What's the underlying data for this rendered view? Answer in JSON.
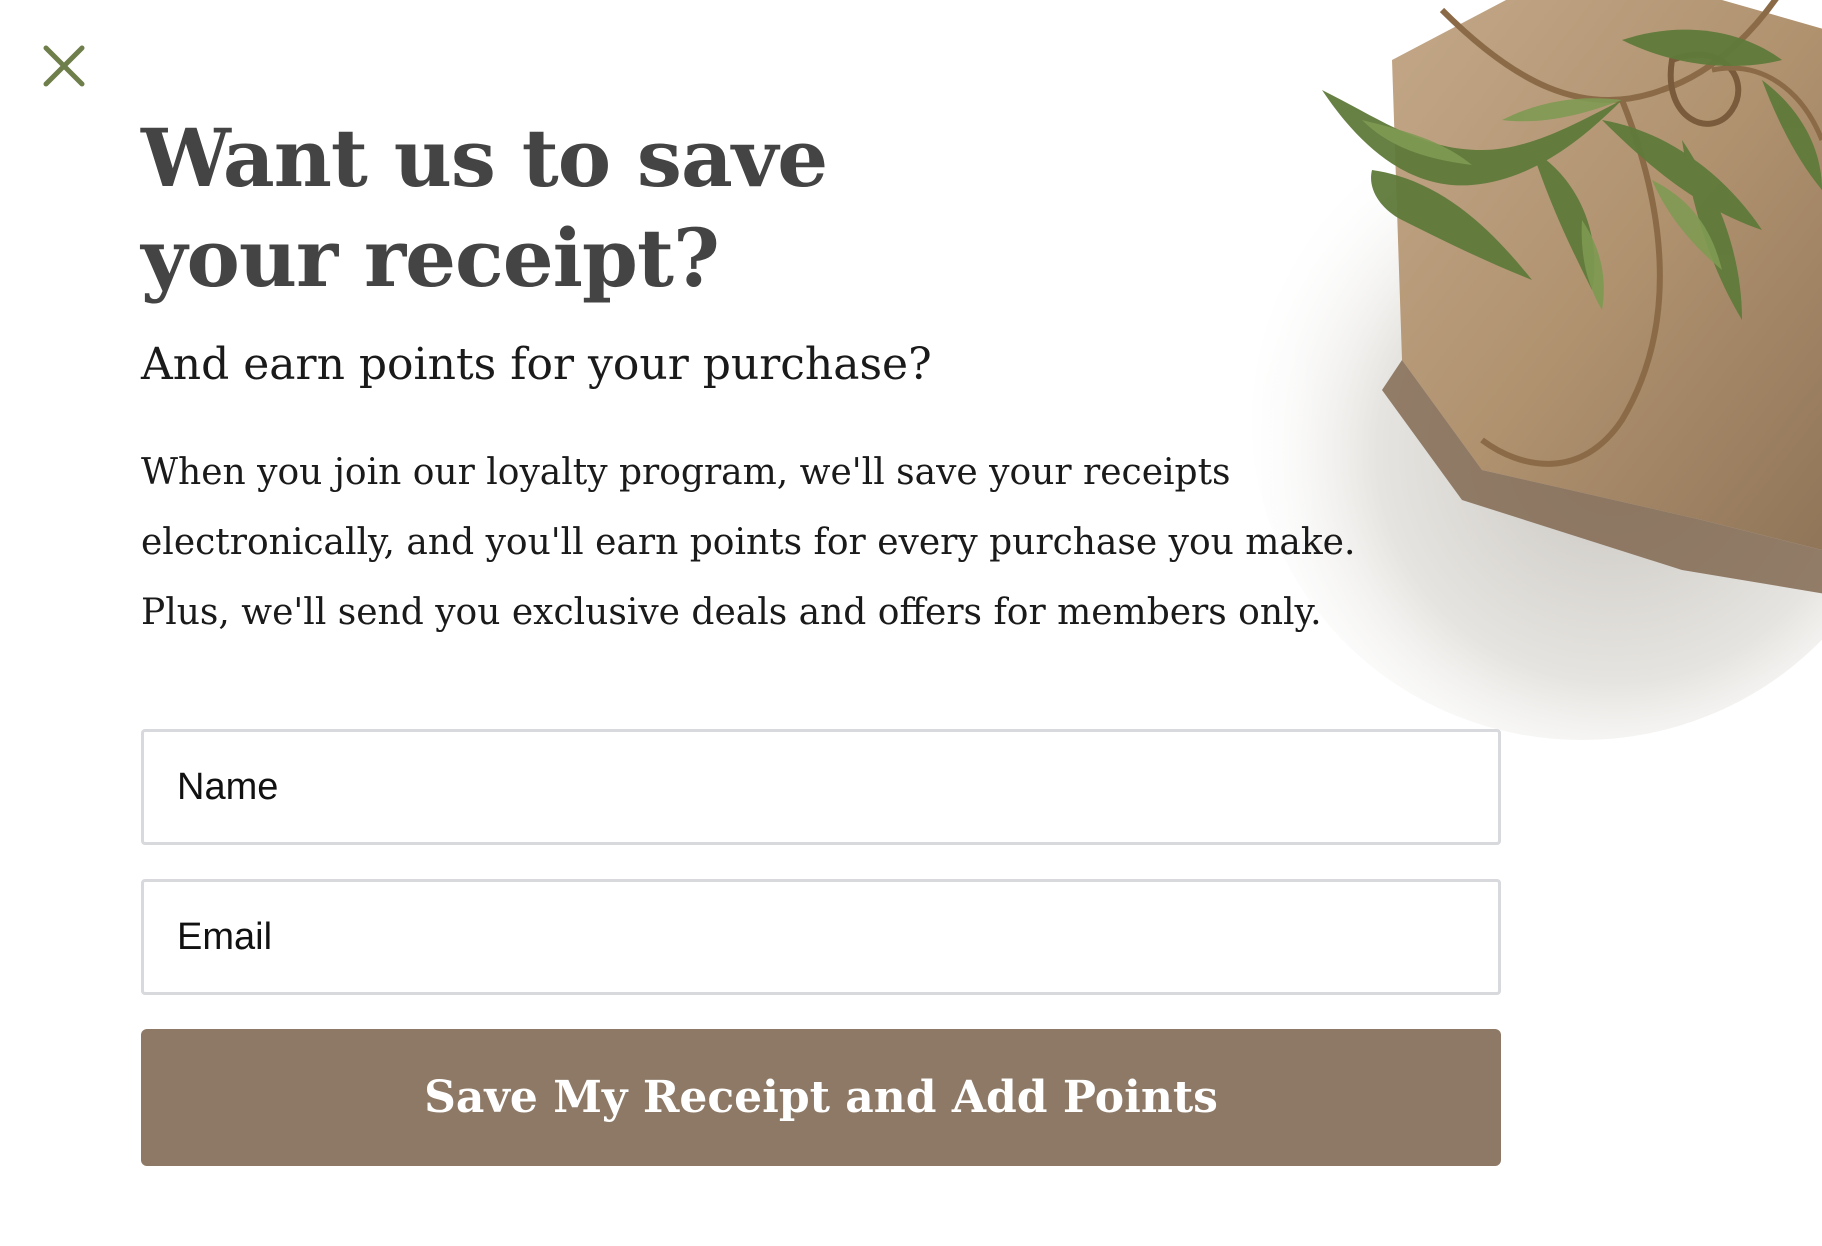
{
  "dialog": {
    "title": "Want us to save your receipt?",
    "subtitle": "And earn points for your purchase?",
    "description": "When you join our loyalty program, we'll save your receipts electronically, and you'll earn points for every purchase you make. Plus, we'll send you exclusive deals and offers for members only.",
    "close_icon": "close-icon",
    "decor_image": "gift-box-with-greenery-photo"
  },
  "form": {
    "name_placeholder": "Name",
    "email_placeholder": "Email",
    "submit_label": "Save My Receipt and Add Points"
  },
  "colors": {
    "title": "#444444",
    "text": "#1a1a1a",
    "button": "#8d7966",
    "close_icon": "#6f7f4b",
    "field_border": "#d7d9dd"
  }
}
